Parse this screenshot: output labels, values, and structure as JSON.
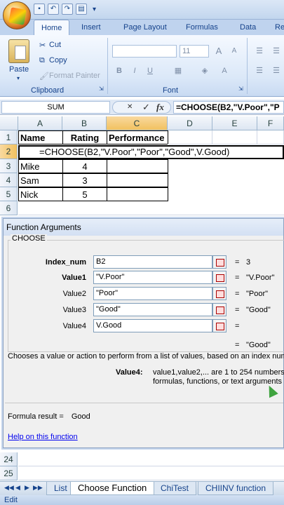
{
  "ribbon": {
    "tabs": [
      "Home",
      "Insert",
      "Page Layout",
      "Formulas",
      "Data",
      "Re"
    ],
    "clipboard": {
      "paste": "Paste",
      "cut": "Cut",
      "copy": "Copy",
      "format_painter": "Format Painter",
      "label": "Clipboard"
    },
    "font": {
      "size": "11",
      "grow": "A",
      "shrink": "A",
      "bold": "B",
      "italic": "I",
      "underline": "U",
      "label": "Font"
    }
  },
  "formula_bar": {
    "name_box": "SUM",
    "cancel": "✕",
    "enter": "✓",
    "fx": "fx",
    "formula": "=CHOOSE(B2,\"V.Poor\",\"P"
  },
  "grid": {
    "columns": [
      "A",
      "B",
      "C",
      "D",
      "E",
      "F"
    ],
    "rows": [
      "1",
      "2",
      "3",
      "4",
      "5",
      "6",
      "24",
      "25"
    ],
    "header": {
      "name": "Name",
      "rating": "Rating",
      "performance": "Performance"
    },
    "edit_text": "=CHOOSE(B2,\"V.Poor\",\"Poor\",\"Good\",V.Good)",
    "data": [
      {
        "name": "Mike",
        "rating": "4"
      },
      {
        "name": "Sam",
        "rating": "3"
      },
      {
        "name": "Nick",
        "rating": "5"
      }
    ]
  },
  "dialog": {
    "title": "Function Arguments",
    "function_name": "CHOOSE",
    "args": [
      {
        "label": "Index_num",
        "value": "B2",
        "result": "3"
      },
      {
        "label": "Value1",
        "value": "\"V.Poor\"",
        "result": "\"V.Poor\""
      },
      {
        "label": "Value2",
        "value": "\"Poor\"",
        "result": "\"Poor\""
      },
      {
        "label": "Value3",
        "value": "\"Good\"",
        "result": "\"Good\""
      },
      {
        "label": "Value4",
        "value": "V.Good",
        "result": ""
      }
    ],
    "eq": "=",
    "overall_result": "\"Good\"",
    "description": "Chooses a value or action to perform from a list of values, based on an index numb",
    "arg_desc_label": "Value4:",
    "arg_desc_line1": "value1,value2,... are 1 to 254 numbers",
    "arg_desc_line2": "formulas, functions, or text arguments",
    "formula_result_label": "Formula result =",
    "formula_result_value": "Good",
    "help_link": "Help on this function"
  },
  "sheets": {
    "nav": [
      "◀◀",
      "◀",
      "▶",
      "▶▶"
    ],
    "tabs": [
      "List",
      "Choose Function",
      "ChiTest",
      "CHIINV function"
    ]
  },
  "status": {
    "mode": "Edit"
  }
}
